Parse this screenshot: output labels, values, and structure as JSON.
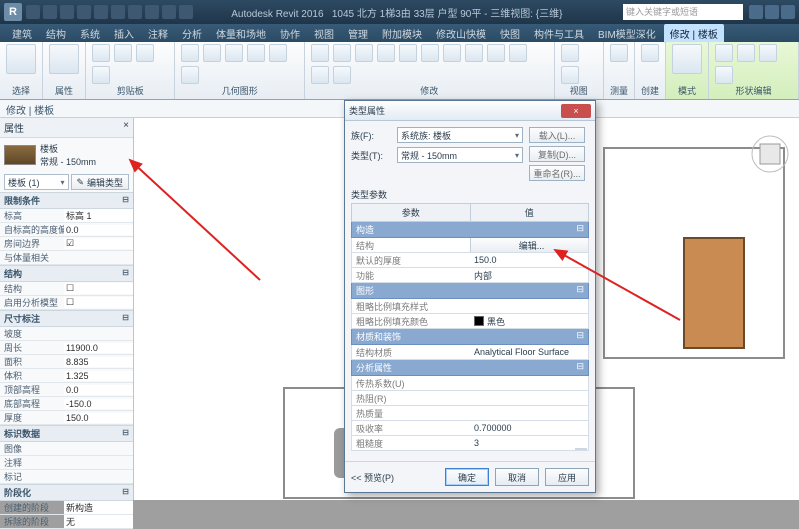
{
  "title": {
    "app": "Autodesk Revit 2016",
    "doc": "1045 北方 1梯3由 33层 户型 90平 - 三维视图: {三维}"
  },
  "search_placeholder": "键入关键字或短语",
  "menu": [
    "建筑",
    "结构",
    "系统",
    "插入",
    "注释",
    "分析",
    "体量和场地",
    "协作",
    "视图",
    "管理",
    "附加模块",
    "修改山快模",
    "快图",
    "构件与工具",
    "BIM模型深化",
    "修改 | 楼板"
  ],
  "menu_active_index": 15,
  "ribbon_groups": [
    "选择",
    "属性",
    "剪贴板",
    "几何图形",
    "修改",
    "视图",
    "测量",
    "创建",
    "模式",
    "形状编辑"
  ],
  "subheader": "修改 | 楼板",
  "properties": {
    "title": "属性",
    "type_name": "楼板",
    "type_variant": "常规 - 150mm",
    "instance_combo": "楼板 (1)",
    "edit_type_btn": "编辑类型",
    "sections": {
      "constraints": {
        "label": "限制条件",
        "rows": [
          {
            "k": "标高",
            "v": "标高 1"
          },
          {
            "k": "自标高的高度偏移",
            "v": "0.0"
          },
          {
            "k": "房间边界",
            "v": "☑"
          },
          {
            "k": "与体量相关",
            "v": ""
          }
        ]
      },
      "structural": {
        "label": "结构",
        "rows": [
          {
            "k": "结构",
            "v": "☐"
          },
          {
            "k": "启用分析模型",
            "v": "☐"
          }
        ]
      },
      "dims": {
        "label": "尺寸标注",
        "rows": [
          {
            "k": "坡度",
            "v": ""
          },
          {
            "k": "周长",
            "v": "11900.0"
          },
          {
            "k": "面积",
            "v": "8.835"
          },
          {
            "k": "体积",
            "v": "1.325"
          },
          {
            "k": "顶部高程",
            "v": "0.0"
          },
          {
            "k": "底部高程",
            "v": "-150.0"
          },
          {
            "k": "厚度",
            "v": "150.0"
          }
        ]
      },
      "iddata": {
        "label": "标识数据",
        "rows": [
          {
            "k": "图像",
            "v": ""
          },
          {
            "k": "注释",
            "v": ""
          },
          {
            "k": "标记",
            "v": ""
          }
        ]
      },
      "phasing": {
        "label": "阶段化",
        "rows": [
          {
            "k": "创建的阶段",
            "v": "新构造"
          },
          {
            "k": "拆除的阶段",
            "v": "无"
          }
        ]
      }
    }
  },
  "dialog": {
    "title": "类型属性",
    "family_label": "族(F):",
    "family_value": "系统族: 楼板",
    "type_label": "类型(T):",
    "type_value": "常规 - 150mm",
    "btn_load": "载入(L)...",
    "btn_dup": "复制(D)...",
    "btn_rename": "重命名(R)...",
    "params_label": "类型参数",
    "col_param": "参数",
    "col_value": "值",
    "sections": [
      {
        "label": "构造",
        "rows": [
          {
            "k": "结构",
            "v": "编辑...",
            "btn": true
          },
          {
            "k": "默认的厚度",
            "v": "150.0"
          },
          {
            "k": "功能",
            "v": "内部"
          }
        ]
      },
      {
        "label": "图形",
        "rows": [
          {
            "k": "粗略比例填充样式",
            "v": ""
          },
          {
            "k": "粗略比例填充颜色",
            "v": "黑色",
            "swatch": true
          }
        ]
      },
      {
        "label": "材质和装饰",
        "rows": [
          {
            "k": "结构材质",
            "v": "Analytical Floor Surface"
          }
        ]
      },
      {
        "label": "分析属性",
        "rows": [
          {
            "k": "传热系数(U)",
            "v": ""
          },
          {
            "k": "热阻(R)",
            "v": ""
          },
          {
            "k": "热质量",
            "v": ""
          },
          {
            "k": "吸收率",
            "v": "0.700000"
          },
          {
            "k": "粗糙度",
            "v": "3"
          }
        ]
      }
    ],
    "btn_preview": "<< 预览(P)",
    "btn_ok": "确定",
    "btn_cancel": "取消",
    "btn_apply": "应用"
  }
}
